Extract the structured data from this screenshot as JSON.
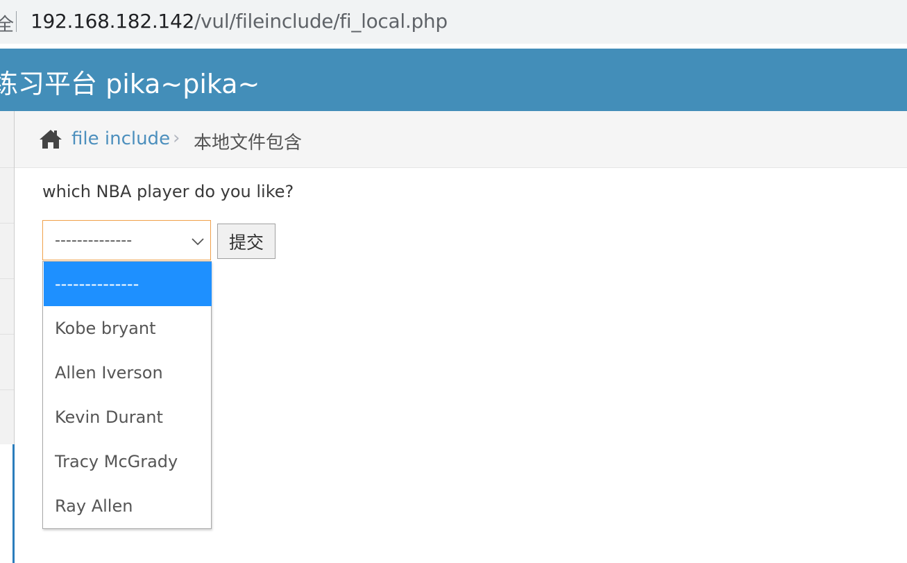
{
  "browser": {
    "lock_fragment": "全",
    "url_host": "192.168.182.142",
    "url_path": "/vul/fileinclude/fi_local.php"
  },
  "header": {
    "brand": "练习平台 pika~pika~",
    "bg_color": "#438eb9"
  },
  "breadcrumbs": {
    "home_icon": "home-icon",
    "link_label": "file include",
    "separator": "›",
    "current_label": "本地文件包含"
  },
  "form": {
    "question": "which NBA player do you like?",
    "select_value": "--------------",
    "submit_label": "提交",
    "options": [
      "--------------",
      "Kobe bryant",
      "Allen Iverson",
      "Kevin Durant",
      "Tracy McGrady",
      "Ray Allen"
    ],
    "selected_index": 0,
    "highlight_color": "#1e90ff"
  }
}
